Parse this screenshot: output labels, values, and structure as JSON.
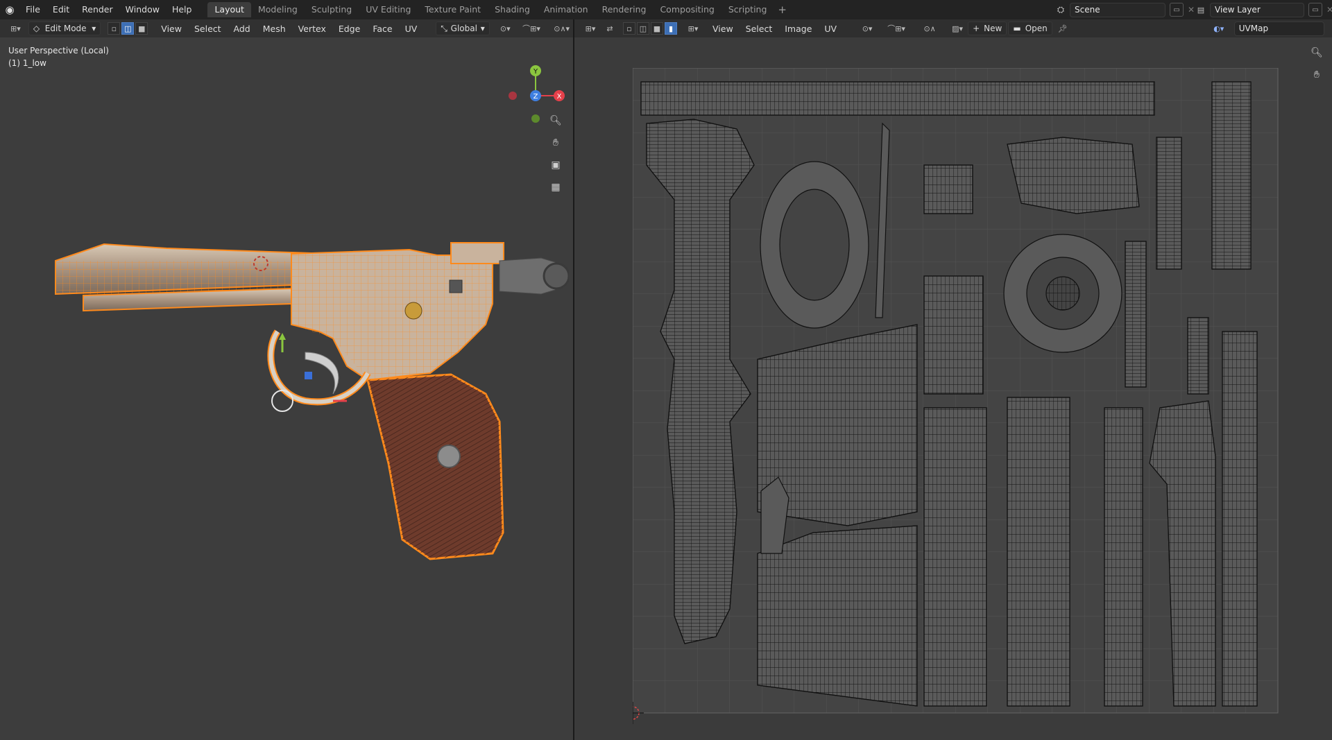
{
  "menus": [
    "File",
    "Edit",
    "Render",
    "Window",
    "Help"
  ],
  "workspaces": [
    "Layout",
    "Modeling",
    "Sculpting",
    "UV Editing",
    "Texture Paint",
    "Shading",
    "Animation",
    "Rendering",
    "Compositing",
    "Scripting"
  ],
  "active_workspace": "Layout",
  "scene": {
    "label": "Scene"
  },
  "view_layer": {
    "label": "View Layer"
  },
  "viewport": {
    "mode": "Edit Mode",
    "menus": [
      "View",
      "Select",
      "Add",
      "Mesh",
      "Vertex",
      "Edge",
      "Face",
      "UV"
    ],
    "orientation": "Global",
    "perspective_label": "User Perspective (Local)",
    "object_label": "(1) 1_low",
    "gizmo": {
      "y": "Y",
      "z": "Z",
      "x": "X"
    }
  },
  "uv_editor": {
    "menus": [
      "View",
      "Select",
      "Image",
      "UV"
    ],
    "new_label": "New",
    "open_label": "Open",
    "uvmap": "UVMap"
  },
  "colors": {
    "accent": "#3d6fb5",
    "selection": "#ff8a1c",
    "grid": "#535353",
    "wire": "#111111"
  }
}
